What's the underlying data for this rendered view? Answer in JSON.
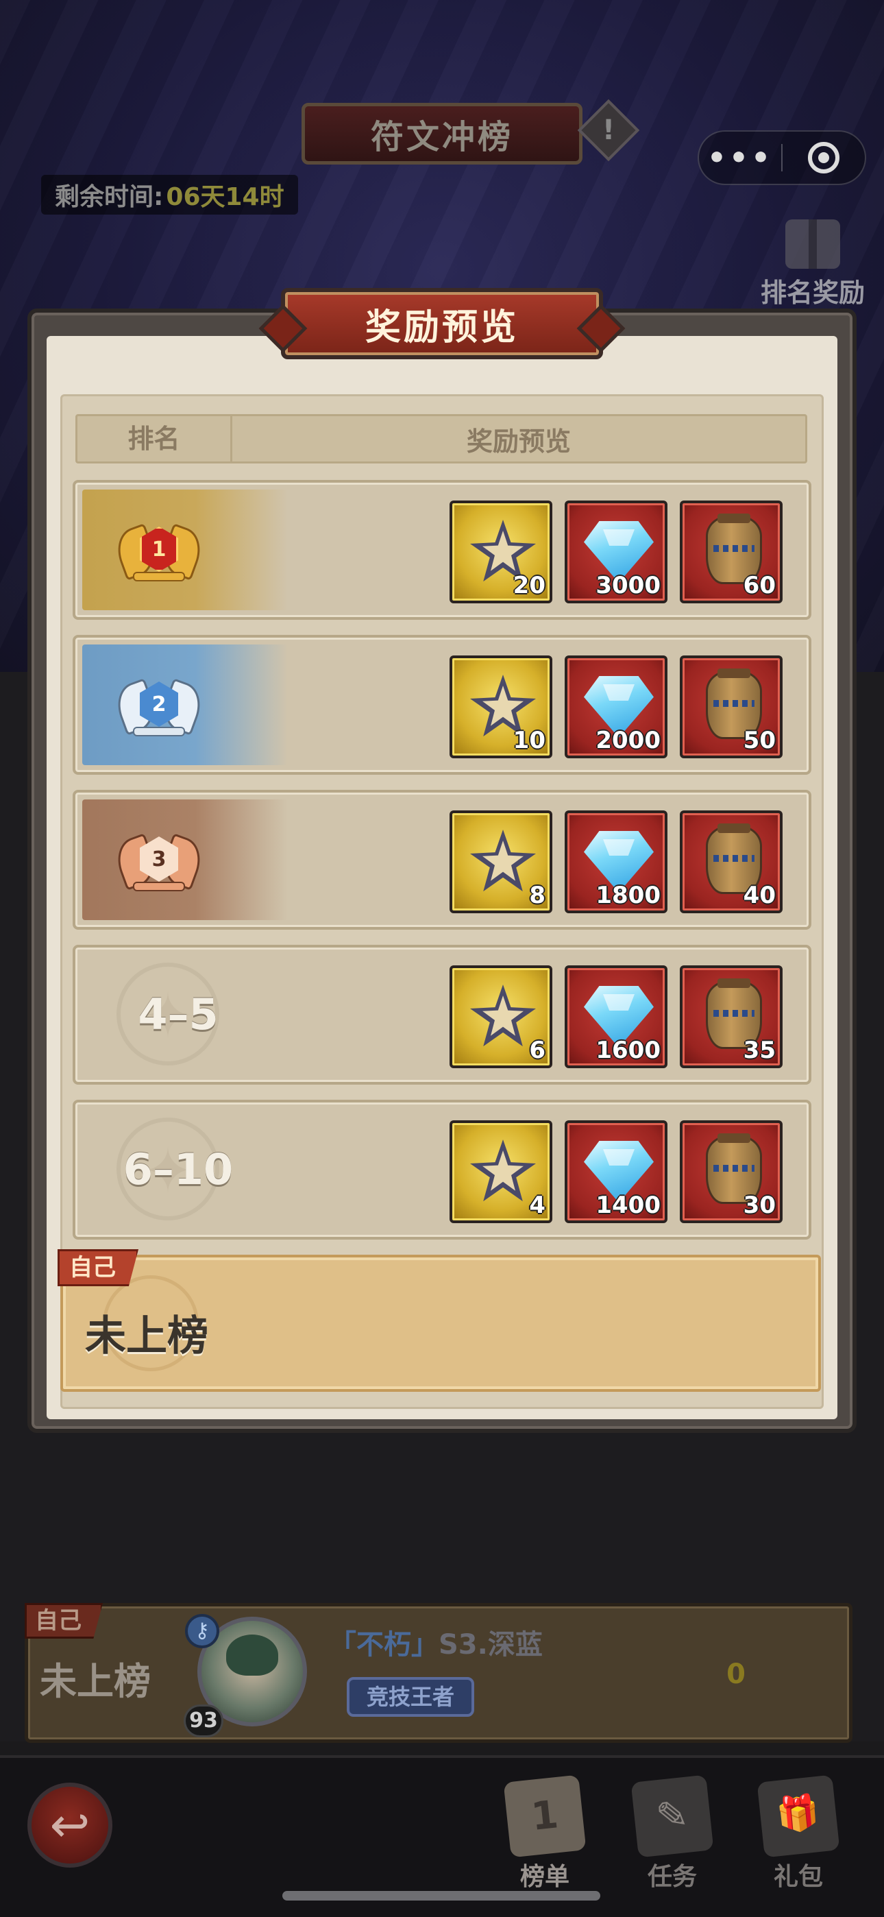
{
  "top_bar": {
    "title": "符文冲榜",
    "info_icon": "exclamation-icon",
    "more_label": "•••",
    "remaining_label": "剩余时间:",
    "remaining_value": "06天14时",
    "rank_reward_label": "排名奖励"
  },
  "modal": {
    "title": "奖励预览",
    "header_rank": "排名",
    "header_rewards": "奖励预览",
    "rows": [
      {
        "rank": "1",
        "medal": "gold",
        "rewards": [
          {
            "icon": "rune-star-icon",
            "count": "20"
          },
          {
            "icon": "diamond-icon",
            "count": "3000"
          },
          {
            "icon": "pot-icon",
            "count": "60"
          }
        ]
      },
      {
        "rank": "2",
        "medal": "silver",
        "rewards": [
          {
            "icon": "rune-star-icon",
            "count": "10"
          },
          {
            "icon": "diamond-icon",
            "count": "2000"
          },
          {
            "icon": "pot-icon",
            "count": "50"
          }
        ]
      },
      {
        "rank": "3",
        "medal": "bronze",
        "rewards": [
          {
            "icon": "rune-star-icon",
            "count": "8"
          },
          {
            "icon": "diamond-icon",
            "count": "1800"
          },
          {
            "icon": "pot-icon",
            "count": "40"
          }
        ]
      },
      {
        "rank": "4–5",
        "medal": "none",
        "rewards": [
          {
            "icon": "rune-star-icon",
            "count": "6"
          },
          {
            "icon": "diamond-icon",
            "count": "1600"
          },
          {
            "icon": "pot-icon",
            "count": "35"
          }
        ]
      },
      {
        "rank": "6–10",
        "medal": "none",
        "rewards": [
          {
            "icon": "rune-star-icon",
            "count": "4"
          },
          {
            "icon": "diamond-icon",
            "count": "1400"
          },
          {
            "icon": "pot-icon",
            "count": "30"
          }
        ]
      }
    ],
    "self_tag": "自己",
    "self_status": "未上榜"
  },
  "bottom_self": {
    "tag": "自己",
    "status": "未上榜",
    "level": "93",
    "title_tag": "「不朽」",
    "player_name": "S3.深蓝",
    "badge": "竞技王者",
    "score": "0"
  },
  "nav": {
    "back_icon": "back-arrow-icon",
    "items": [
      {
        "label": "榜单",
        "active": true
      },
      {
        "label": "任务",
        "active": false
      },
      {
        "label": "礼包",
        "active": false
      }
    ]
  },
  "colors": {
    "modal_title_bg": "#a83a2a",
    "gold_rank": "#c4a24e",
    "silver_rank": "#6e9cc4",
    "bronze_rank": "#a2775c",
    "self_row_bg": "#dfbf88"
  }
}
